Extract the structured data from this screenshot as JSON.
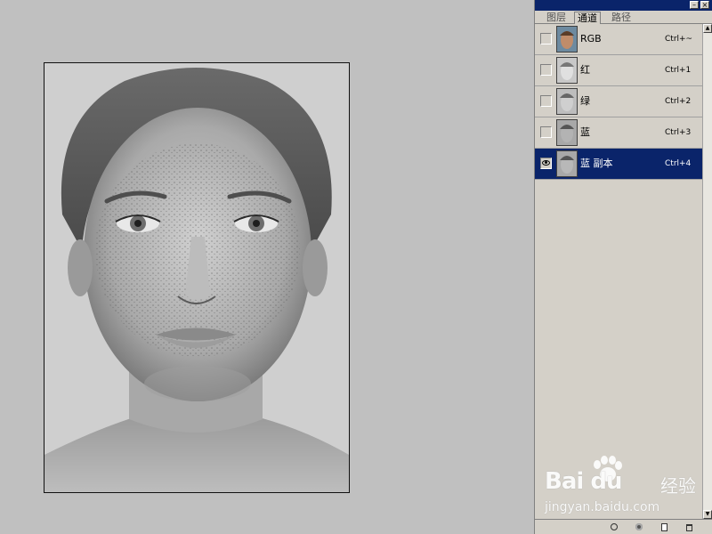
{
  "panel": {
    "tabs": [
      {
        "label": "图层"
      },
      {
        "label": "通道"
      },
      {
        "label": "路径"
      }
    ],
    "active_tab": "通道",
    "selection_color": "#0a246a",
    "channels": [
      {
        "name": "RGB",
        "shortcut": "Ctrl+~",
        "thumb": "color",
        "visible": false
      },
      {
        "name": "红",
        "shortcut": "Ctrl+1",
        "thumb": "gray",
        "visible": false
      },
      {
        "name": "绿",
        "shortcut": "Ctrl+2",
        "thumb": "gray",
        "visible": false
      },
      {
        "name": "蓝",
        "shortcut": "Ctrl+3",
        "thumb": "gray",
        "visible": false
      },
      {
        "name": "蓝 副本",
        "shortcut": "Ctrl+4",
        "thumb": "gray",
        "visible": true,
        "selected": true
      }
    ],
    "bottom_icons": [
      "load-selection-icon",
      "save-selection-icon",
      "new-channel-icon",
      "trash-icon"
    ]
  },
  "canvas": {
    "subject": "grayscale portrait of freckled woman",
    "mode": "grayscale"
  },
  "watermark": {
    "logo": "Bai du",
    "subtitle": "经验",
    "url": "jingyan.baidu.com"
  }
}
